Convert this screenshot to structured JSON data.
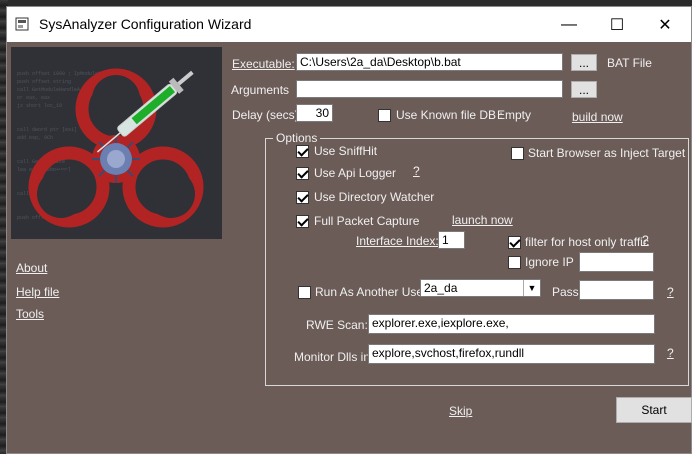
{
  "window": {
    "title": "SysAnalyzer Configuration Wizard",
    "minimize": "—",
    "maximize": "☐",
    "close": "✕"
  },
  "side_links": {
    "about": "About",
    "help": "Help file",
    "tools": "Tools"
  },
  "form": {
    "executable_label": "Executable:",
    "executable_value": "C:\\Users\\2a_da\\Desktop\\b.bat",
    "browse_label": "...",
    "file_type": "BAT File",
    "arguments_label": "Arguments",
    "arguments_value": "",
    "delay_label": "Delay (secs)",
    "delay_value": "30",
    "known_db_label": "Use Known file DB :",
    "known_db_status": "Empty",
    "build_now": "build now"
  },
  "options": {
    "legend": "Options",
    "sniffhit": "Use SniffHit",
    "api_logger": "Use Api Logger",
    "api_help": "?",
    "dir_watcher": "Use Directory Watcher",
    "packet_capture": "Full Packet Capture",
    "launch_now": "launch now",
    "browser_inject": "Start Browser as Inject Target",
    "interface_label": "Interface Index:",
    "interface_value": "1",
    "filter_host": "filter for host only traffic",
    "filter_help": "?",
    "ignore_ip": "Ignore IP",
    "ignore_ip_value": "",
    "run_as_user": "Run As Another User",
    "user_value": "2a_da",
    "pass_label": "Pass",
    "pass_value": "",
    "pass_help": "?",
    "rwe_label": "RWE Scan:",
    "rwe_value": "explorer.exe,iexplore.exe,",
    "monitor_label": "Monitor Dlls in:",
    "monitor_value": "explore,svchost,firefox,rundll",
    "monitor_help": "?"
  },
  "footer": {
    "skip": "Skip",
    "start": "Start"
  },
  "colors": {
    "window_bg": "#6b5c57",
    "biohazard": "#b22424",
    "syringe_liquid": "#1fae2a"
  }
}
